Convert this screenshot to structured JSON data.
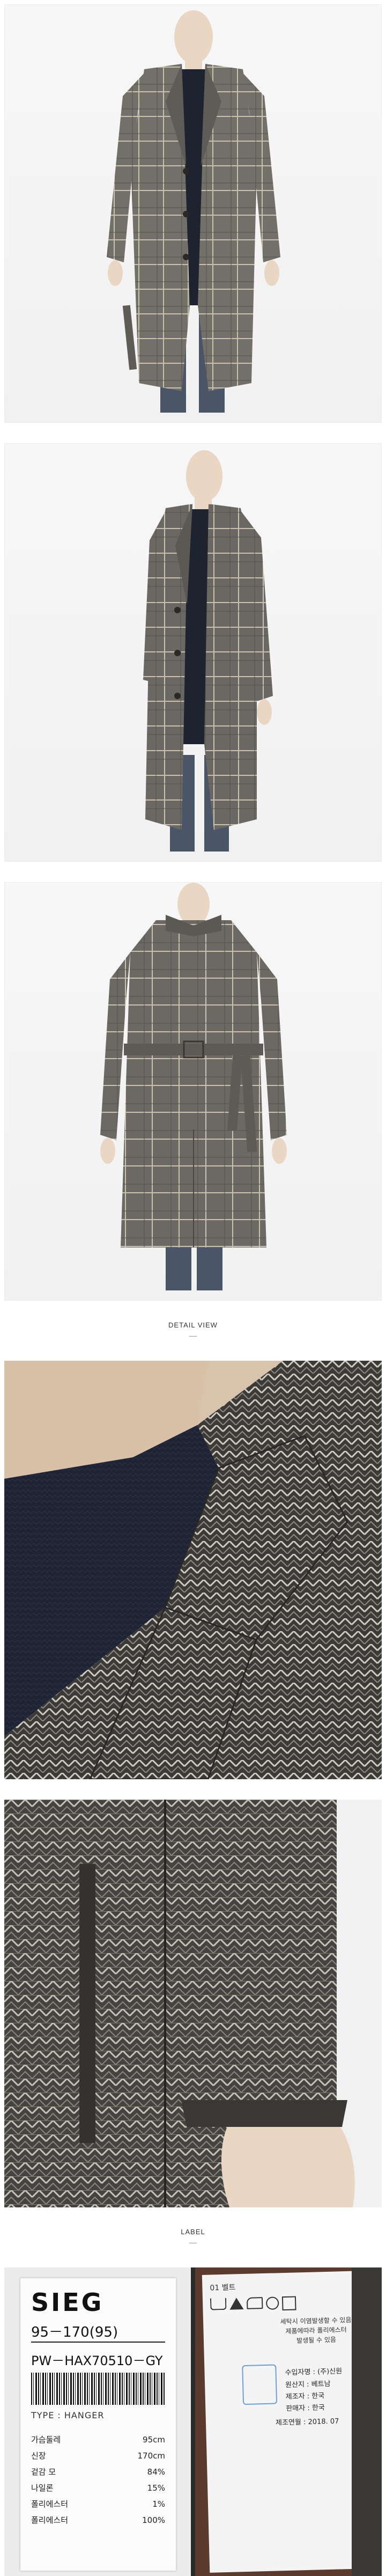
{
  "sections": {
    "detail_view": "DETAIL VIEW",
    "label": "LABEL"
  },
  "label_card": {
    "brand": "SIEG",
    "size": "95－170(95)",
    "code": "PW－HAX70510－GY",
    "type": "TYPE : HANGER",
    "spec_lines": [
      {
        "name": "가슴둘레",
        "value": "95cm"
      },
      {
        "name": "신장",
        "value": "170cm"
      },
      {
        "name": "겉감 모",
        "value": "84%"
      },
      {
        "name": "나일론",
        "value": "15%"
      },
      {
        "name": "폴리에스터",
        "value": "1%"
      },
      {
        "name": "폴리에스터",
        "value": "100%"
      }
    ]
  },
  "care_label": {
    "top_line": "01    벨트",
    "notice": [
      "세탁시 이염발생할 수 있음",
      "제품에따라 폴리에스터",
      "발생될 수 있음"
    ],
    "importer_label": "수입자명 :",
    "importer": "(주)신원",
    "origin_label": "원산지 : 베트남",
    "maker_label": "제조자 : 한국",
    "seller_label": "판매자 : 한국",
    "date_label": "제조연월 : 2018. 07"
  },
  "colors": {
    "coat_base": "#6e6b66",
    "check_line": "#c9c2ae",
    "sweater": "#1e2330",
    "jeans": "#4a5568",
    "skin": "#e9d6c3"
  }
}
